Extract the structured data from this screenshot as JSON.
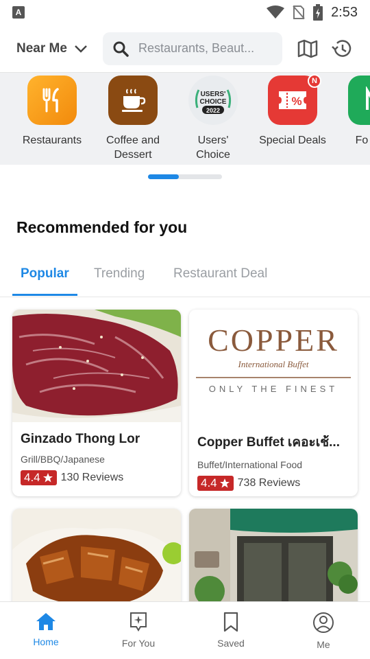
{
  "statusbar": {
    "time": "2:53",
    "left_badge": "A"
  },
  "header": {
    "location_label": "Near Me",
    "search_placeholder": "Restaurants, Beaut..."
  },
  "categories": [
    {
      "label": "Restaurants",
      "icon": "fork-knife-icon",
      "color": "#f59a16"
    },
    {
      "label": "Coffee and Dessert",
      "icon": "coffee-cup-icon",
      "color": "#8a4a12"
    },
    {
      "label": "Users' Choice",
      "icon": "users-choice-2022-icon",
      "color": "#e9ecef",
      "icon_text": [
        "USERS'",
        "CHOICE",
        "2022"
      ]
    },
    {
      "label": "Special Deals",
      "icon": "coupon-percent-icon",
      "color": "#e53935",
      "badge": "N"
    },
    {
      "label": "Fo Deli",
      "icon": "food-delivery-icon",
      "color": "#1faa59"
    }
  ],
  "pager": {
    "active_fraction": 0.42
  },
  "section": {
    "title": "Recommended for you"
  },
  "tabs": [
    {
      "label": "Popular",
      "active": true
    },
    {
      "label": "Trending",
      "active": false
    },
    {
      "label": "Restaurant Deal",
      "active": false
    }
  ],
  "cards": [
    {
      "name": "Ginzado Thong Lor",
      "category": "Grill/BBQ/Japanese",
      "rating": "4.4",
      "reviews": "130 Reviews",
      "image": "marbled-beef-photo"
    },
    {
      "name": "Copper Buffet เคอะเช้...",
      "category": "Buffet/International Food",
      "rating": "4.4",
      "reviews": "738 Reviews",
      "image": "copper-logo",
      "logo_text": {
        "brand": "COPPER",
        "script": "International Buffet",
        "tagline": "ONLY THE FINEST"
      }
    },
    {
      "image": "glazed-pork-rice-photo"
    },
    {
      "image": "restaurant-storefront-photo"
    }
  ],
  "bottom_nav": [
    {
      "label": "Home",
      "icon": "home-icon",
      "active": true
    },
    {
      "label": "For You",
      "icon": "for-you-icon",
      "active": false
    },
    {
      "label": "Saved",
      "icon": "bookmark-icon",
      "active": false
    },
    {
      "label": "Me",
      "icon": "profile-icon",
      "active": false
    }
  ],
  "colors": {
    "accent": "#1e88e5",
    "rating": "#c62828"
  }
}
